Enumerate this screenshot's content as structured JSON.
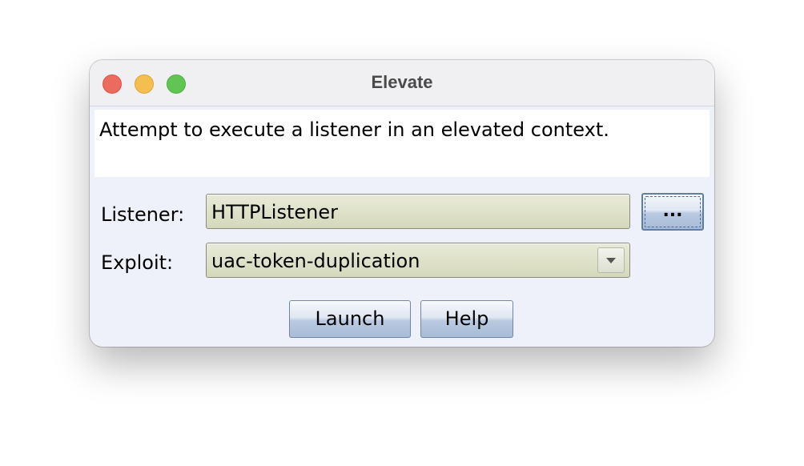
{
  "window": {
    "title": "Elevate"
  },
  "description": "Attempt to execute a listener in an elevated context.",
  "form": {
    "listener_label": "Listener:",
    "listener_value": "HTTPListener",
    "browse_label": "...",
    "exploit_label": "Exploit:",
    "exploit_value": "uac-token-duplication"
  },
  "actions": {
    "launch_label": "Launch",
    "help_label": "Help"
  },
  "icons": {
    "close": "close-traffic-light-icon",
    "minimize": "minimize-traffic-light-icon",
    "maximize": "maximize-traffic-light-icon",
    "dropdown": "chevron-down-icon"
  },
  "colors": {
    "close": "#ed6a5e",
    "minimize": "#f5bf4f",
    "maximize": "#61c554",
    "field_background": "#dfe2c9",
    "window_background": "#eef1f9"
  }
}
